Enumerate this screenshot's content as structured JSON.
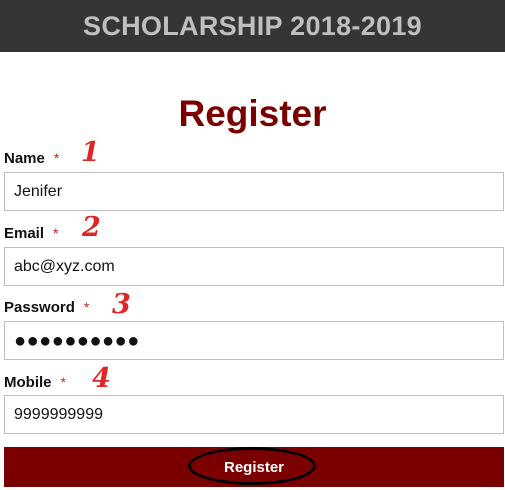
{
  "header": {
    "title": "SCHOLARSHIP 2018-2019"
  },
  "form": {
    "title": "Register",
    "required_marker": "*",
    "fields": [
      {
        "label": "Name",
        "value": "Jenifer",
        "annotation": "1"
      },
      {
        "label": "Email",
        "value": "abc@xyz.com",
        "annotation": "2"
      },
      {
        "label": "Password",
        "value": "●●●●●●●●●●",
        "annotation": "3"
      },
      {
        "label": "Mobile",
        "value": "9999999999",
        "annotation": "4"
      }
    ],
    "submit_label": "Register"
  },
  "colors": {
    "header_bg": "#353535",
    "header_text": "#bfbfbf",
    "accent": "#7a0000",
    "annotation": "#e02525"
  }
}
